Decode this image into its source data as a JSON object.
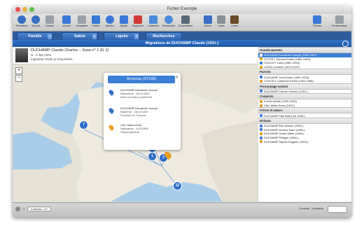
{
  "window": {
    "title": "Fichier Exemple"
  },
  "toolbar": {
    "items": [
      {
        "label": "Précédent",
        "icon": "back-arrow-icon",
        "color": "#3a6fc4"
      },
      {
        "label": "Suivant",
        "icon": "forward-arrow-icon",
        "color": "#3a6fc4"
      },
      {
        "label": "Dossier",
        "icon": "folder-icon",
        "color": "#9aa0a8"
      },
      {
        "label": "Accueil",
        "icon": "home-icon",
        "color": "#3a78d8"
      },
      {
        "label": "Enregistrer",
        "icon": "save-icon",
        "color": "#9aa0a8"
      },
      {
        "label": "Publier",
        "icon": "publish-icon",
        "color": "#3a78d8"
      },
      {
        "label": "Synchro",
        "icon": "sync-icon",
        "color": "#3a78d8"
      },
      {
        "label": "Ajouter",
        "icon": "add-icon",
        "color": "#3a78d8"
      },
      {
        "label": "Supprimer",
        "icon": "delete-icon",
        "color": "#d23a3a"
      },
      {
        "label": "Collection",
        "icon": "collection-icon",
        "color": "#4a8ad8"
      },
      {
        "label": "Rechercher",
        "icon": "search-icon",
        "color": "#4a8ad8"
      },
      {
        "label": "Dictionnaires",
        "icon": "dictionary-icon",
        "color": "#5a6a78"
      }
    ],
    "right_items": [
      {
        "label": "Arbres",
        "icon": "tree-icon",
        "color": "#3a6fc4"
      },
      {
        "label": "Listes",
        "icon": "list-icon",
        "color": "#8a9098"
      },
      {
        "label": "Livres",
        "icon": "book-icon",
        "color": "#6a4a2a"
      },
      {
        "label": "Thèmes",
        "icon": "themes-icon",
        "color": "#3a78d8"
      },
      {
        "label": "Personnaliser",
        "icon": "customize-icon",
        "color": "#9aa0a8"
      }
    ]
  },
  "tabs": {
    "famille": "Famille",
    "saisie": "Saisie",
    "lignee": "Lignée",
    "recherches": "Recherches"
  },
  "panel": {
    "title": "Migrations de DUCHAMP Claude (1931-)"
  },
  "person": {
    "name": "DUCHAMP Claude Charles",
    "sosa": "Sosa n° 1 (G 1)",
    "birth": "N : 3 Jan 1931",
    "profession": "Ingénieur Ponts & Chaussées"
  },
  "popup": {
    "title": "Annonay (07100)",
    "entries": [
      {
        "name": "DUCHAMP Alexandre Joseph",
        "line1": "Naissance : 18/11/1849",
        "line2": "dans la maison paternelle",
        "color": "#2f6fc8"
      },
      {
        "name": "DUCHAMP Alexandre Joseph",
        "line1": "Baptême : 18/12/1849",
        "line2": "Paroisse St François",
        "color": "#2f6fc8"
      },
      {
        "name": "VIAL Marie-Anne",
        "line1": "Naissance : 10/3/1855",
        "line2": "Hôpital général",
        "color": "#f0a020"
      }
    ]
  },
  "markers": [
    "7",
    "3",
    "1",
    "3",
    "12"
  ],
  "sidebar": {
    "grands_parents": {
      "title": "Grands-parents",
      "items": [
        {
          "text": "DUCHAMP Alexandre Joseph (1849-1907)",
          "selected": true,
          "color": "#3a78d8"
        },
        {
          "text": "COTTET Jeannie Émilie (1865-1949)",
          "color": "#e0a020"
        },
        {
          "text": "COLICKY Louis (1861-1933)",
          "color": "#3a78d8"
        },
        {
          "text": "LOUIS Léontine (1873-1927)",
          "color": "#e0a020"
        }
      ]
    },
    "parents": {
      "title": "Parents",
      "items": [
        {
          "text": "DUCHAMP Jean-Marie (1899-1933)",
          "color": "#3a78d8"
        },
        {
          "text": "COLICKY Catherine Émilie (1902-1988)",
          "color": "#e0a020"
        }
      ]
    },
    "personnage": {
      "title": "Personnage central",
      "items": [
        {
          "text": "DUCHAMP Claude Charles (1931-)",
          "color": "#3a78d8"
        }
      ]
    },
    "conjoints": {
      "title": "Conjoints",
      "items": [
        {
          "text": "KLEIN Arlette (1930-1953)",
          "color": "#e0a020"
        },
        {
          "text": "VIAL Marie-Anne (1923-)",
          "color": "#e0a020"
        }
      ]
    },
    "freres": {
      "title": "Frères et sœurs",
      "items": [
        {
          "text": "DUCHAMP Paul André (N 1935-)",
          "color": "#3a78d8"
        }
      ]
    },
    "enfants": {
      "title": "Enfants",
      "items": [
        {
          "text": "DUCHAMP Éric Antoine (1954-)",
          "color": "#3a78d8"
        },
        {
          "text": "DUCHAMP Jérôme Marc (1956-)",
          "color": "#3a78d8"
        },
        {
          "text": "DUCHAMP Cécile Marie (1958-)",
          "color": "#e0a020"
        },
        {
          "text": "DUCHAMP Philippe (1960-)",
          "color": "#3a78d8"
        },
        {
          "text": "DUCHAMP Sophie Eugénie (1963-)",
          "color": "#e0a020"
        }
      ]
    }
  },
  "status": {
    "index": "Individus : 67",
    "counts": "2 unions · 4 enfants",
    "zoom": "1"
  }
}
